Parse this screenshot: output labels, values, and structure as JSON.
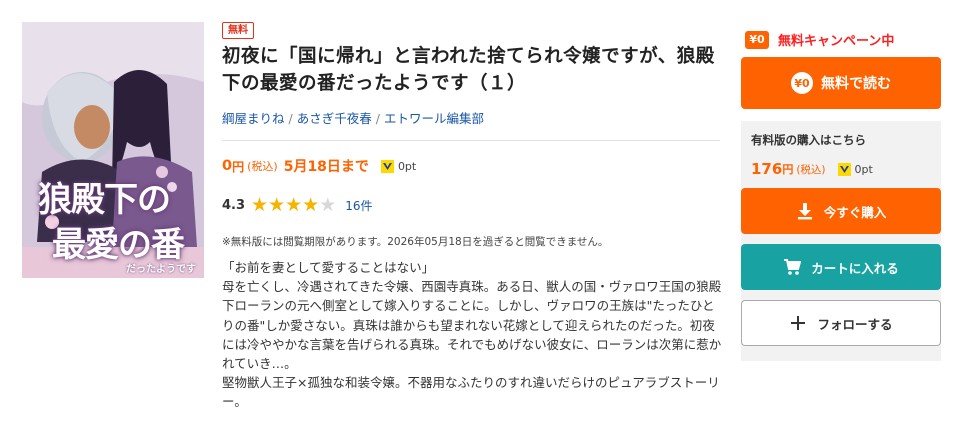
{
  "cover": {
    "image_alt": "狼殿下の最愛の番 cover illustration",
    "cover_title_line1": "狼殿下の",
    "cover_title_line2": "最愛の番",
    "cover_subtitle": "だったようです"
  },
  "product": {
    "badge": "無料",
    "title": "初夜に「国に帰れ」と言われた捨てられ令嬢ですが、狼殿下の最愛の番だったようです（１）",
    "authors": [
      "綱屋まりね",
      "あさぎ千夜春",
      "エトワール編集部"
    ],
    "author_separator": "/",
    "free_price": "0",
    "yen": "円",
    "tax_label": "(税込)",
    "free_until": "5月18日まで",
    "free_points": "0pt",
    "rating": "4.3",
    "rating_stars": 4.3,
    "review_count": "16件",
    "free_note": "※無料版には閲覧期限があります。2026年05月18日を過ぎると閲覧できません。",
    "description": "「お前を妻として愛することはない」\n母を亡くし、冷遇されてきた令嬢、西園寺真珠。ある日、獣人の国・ヴァロワ王国の狼殿下ローランの元へ側室として嫁入りすることに。しかし、ヴァロワの王族は\"たったひとりの番\"しか愛さない。真珠は誰からも望まれない花嫁として迎えられたのだった。初夜には冷ややかな言葉を告げられる真珠。それでもめげない彼女に、ローランは次第に惹かれていき…。\n堅物獣人王子×孤独な和装令嬢。不器用なふたりのすれ違いだらけのピュアラブストーリー。"
  },
  "sidebar": {
    "campaign_badge": "¥0",
    "campaign_text": "無料キャンペーン中",
    "free_read_badge": "¥0",
    "free_read_label": "無料で読む",
    "paid_label": "有料版の購入はこちら",
    "paid_price": "176",
    "paid_yen": "円",
    "paid_tax": "(税込)",
    "paid_points": "0pt",
    "buy_label": "今すぐ購入",
    "cart_label": "カートに入れる",
    "follow_label": "フォローする"
  },
  "colors": {
    "accent_orange": "#ff6200",
    "campaign_red": "#ff1f1f",
    "cart_teal": "#19a2a2",
    "link_blue": "#1a56a8",
    "star_gold": "#f5b400"
  }
}
